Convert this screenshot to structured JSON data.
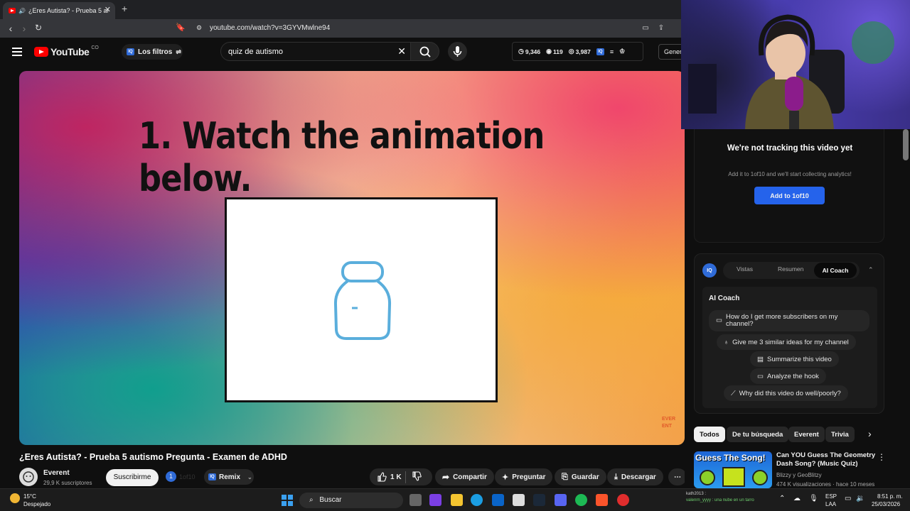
{
  "browser": {
    "tab_title": "¿Eres Autista? - Prueba 5 auti",
    "url": "youtube.com/watch?v=3GYVMwlne94"
  },
  "header": {
    "logo": "YouTube",
    "country": "CO",
    "filters_label": "Los filtros",
    "search_value": "quiz de autismo",
    "stats": {
      "views": "9,346",
      "watching": "119",
      "other": "3,987"
    },
    "generate_label": "Gener"
  },
  "video": {
    "frame_heading": "1. Watch the animation below.",
    "watermark": [
      "EVER",
      "ENT"
    ],
    "title": "¿Eres Autista? - Prueba 5 autismo Pregunta - Examen de ADHD"
  },
  "channel": {
    "name": "Everent",
    "subscribers": "29,9 K suscriptores",
    "subscribe_label": "Suscribirme",
    "badge_count": "1",
    "badge_label": "1of10",
    "remix_label": "Remix"
  },
  "actions": {
    "likes": "1 K",
    "share": "Compartir",
    "ask": "Preguntar",
    "save": "Guardar",
    "download": "Descargar"
  },
  "tracking": {
    "heading": "We're not tracking this video yet",
    "text": "Add it to 1of10 and we'll start collecting analytics!",
    "button": "Add to 1of10"
  },
  "coach": {
    "tabs": [
      "Vistas",
      "Resumen",
      "AI Coach"
    ],
    "title": "AI Coach",
    "suggestions": [
      "How do I get more subscribers on my channel?",
      "Give me 3 similar ideas for my channel",
      "Summarize this video",
      "Analyze the hook",
      "Why did this video do well/poorly?"
    ]
  },
  "chips": [
    "Todos",
    "De tu búsqueda",
    "Everent",
    "Trivia"
  ],
  "recommended": {
    "thumb_text": "Guess The Song!",
    "title": "Can YOU Guess The Geometry Dash Song? (Music Quiz)",
    "channel": "Blizzy y GeoBlitzy",
    "meta": "474 K visualizaciones · hace 10 meses"
  },
  "taskbar": {
    "temp": "15°C",
    "weather": "Despejado",
    "search": "Buscar",
    "lang1": "ESP",
    "lang2": "LAA",
    "time": "8:51 p. m.",
    "date": "25/03/2026",
    "chat_user": "kath2013 :",
    "chat_msg": "valenrn_yyyy : una nube en un tarro"
  }
}
